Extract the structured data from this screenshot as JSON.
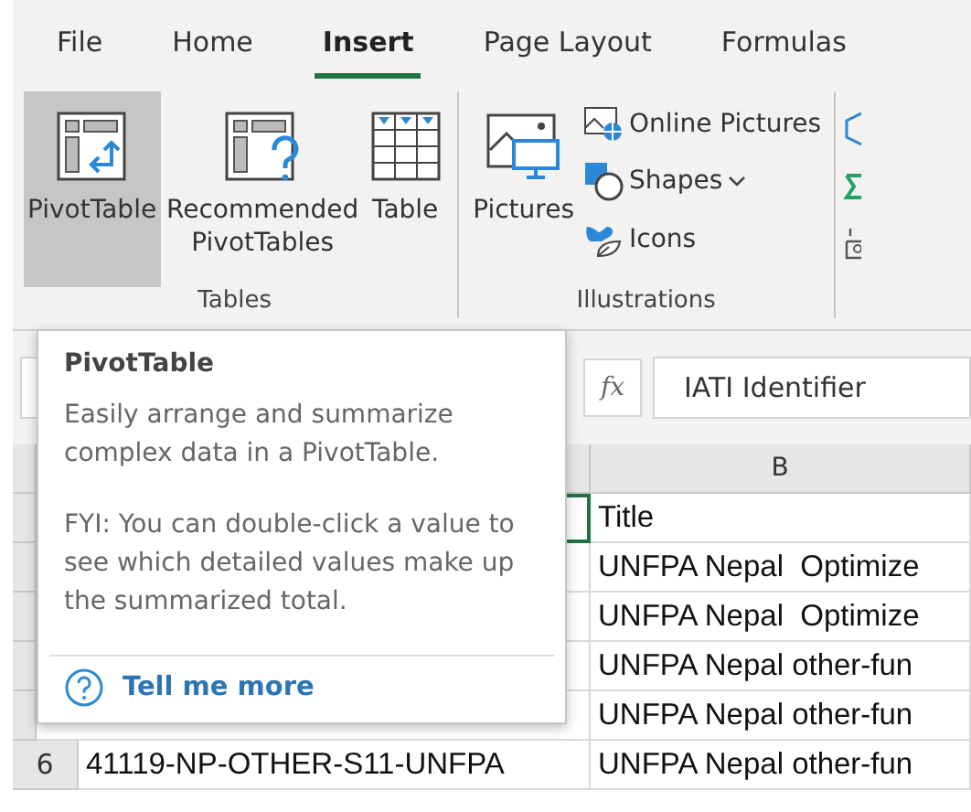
{
  "ribbon_tabs": [
    {
      "label": "File",
      "selected": false
    },
    {
      "label": "Home",
      "selected": false
    },
    {
      "label": "Insert",
      "selected": true
    },
    {
      "label": "Page Layout",
      "selected": false
    },
    {
      "label": "Formulas",
      "selected": false
    }
  ],
  "ribbon_groups": [
    {
      "label": "Tables",
      "buttons": [
        {
          "kind": "large",
          "label": "PivotTable",
          "selected": true
        },
        {
          "kind": "large",
          "label": "Recommended PivotTables",
          "selected": false
        },
        {
          "kind": "large",
          "label": "Table",
          "selected": false
        }
      ]
    },
    {
      "label": "Illustrations",
      "buttons": [
        {
          "kind": "large",
          "label": "Pictures",
          "selected": false
        },
        {
          "kind": "small",
          "label": "Online Pictures",
          "selected": false,
          "dropdown": false
        },
        {
          "kind": "small",
          "label": "Shapes",
          "selected": false,
          "dropdown": true
        },
        {
          "kind": "small",
          "label": "Icons",
          "selected": false,
          "dropdown": false
        }
      ]
    }
  ],
  "formula_bar": {
    "function_symbol": "fx",
    "value": "IATI Identifier"
  },
  "grid": {
    "column_headers": [
      "B"
    ],
    "rows": [
      {
        "b": "Title",
        "a_selected": true
      },
      {
        "b": "UNFPA Nepal  Optimize",
        "a_selected": false
      },
      {
        "b": "UNFPA Nepal  Optimize",
        "a_selected": false
      },
      {
        "b": "UNFPA Nepal other-fun",
        "a_selected": false
      },
      {
        "b": "UNFPA Nepal other-fun",
        "a_selected": false
      },
      {
        "number": "6",
        "a": "41119-NP-OTHER-S11-UNFPA",
        "b": "UNFPA Nepal other-fun",
        "a_selected": false
      }
    ]
  },
  "tooltip": {
    "title": "PivotTable",
    "paragraphs": [
      "Easily arrange and summarize complex data in a PivotTable.",
      "FYI: You can double-click a value to see which detailed values make up the summarized total."
    ],
    "link": "Tell me more"
  }
}
